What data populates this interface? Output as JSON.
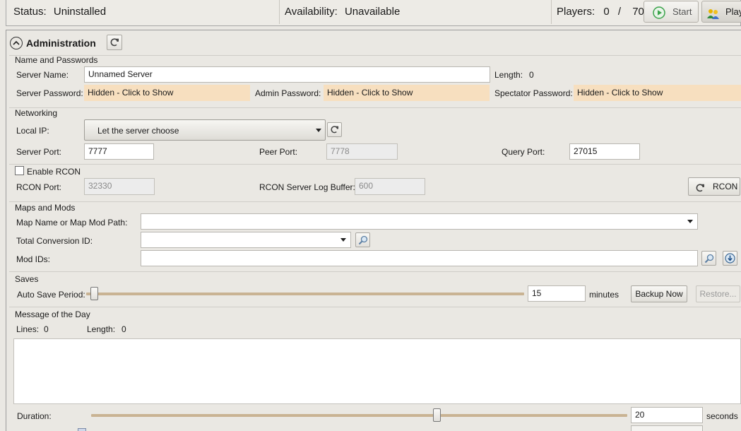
{
  "status_bar": {
    "status_label": "Status:",
    "status_value": "Uninstalled",
    "availability_label": "Availability:",
    "availability_value": "Unavailable",
    "players_label": "Players:",
    "players_current": "0",
    "players_sep": "/",
    "players_max": "70",
    "start_label": "Start",
    "players_button_label": "Playe"
  },
  "admin": {
    "title": "Administration",
    "sections": {
      "names_passwords": "Name and Passwords",
      "networking": "Networking",
      "maps_mods": "Maps and Mods",
      "saves": "Saves",
      "motd": "Message of the Day"
    },
    "server_name_label": "Server Name:",
    "server_name_value": "Unnamed Server",
    "length_label": "Length:",
    "length_value": "0",
    "server_password_label": "Server Password:",
    "server_password_value": "Hidden - Click to Show",
    "admin_password_label": "Admin Password:",
    "admin_password_value": "Hidden - Click to Show",
    "spectator_password_label": "Spectator Password:",
    "spectator_password_value": "Hidden - Click to Show",
    "local_ip_label": "Local IP:",
    "local_ip_value": "Let the server choose",
    "server_port_label": "Server Port:",
    "server_port_value": "7777",
    "peer_port_label": "Peer Port:",
    "peer_port_value": "7778",
    "query_port_label": "Query Port:",
    "query_port_value": "27015",
    "enable_rcon_label": "Enable RCON",
    "rcon_port_label": "RCON Port:",
    "rcon_port_value": "32330",
    "rcon_log_buffer_label": "RCON Server Log Buffer:",
    "rcon_log_buffer_value": "600",
    "rcon_button_label": "RCON",
    "map_label": "Map Name or Map Mod Path:",
    "map_value": "",
    "tc_label": "Total Conversion ID:",
    "tc_value": "",
    "mod_ids_label": "Mod IDs:",
    "mod_ids_value": "",
    "auto_save_label": "Auto Save Period:",
    "auto_save_value": "15",
    "auto_save_unit": "minutes",
    "auto_save_slider_fraction": 0.0,
    "backup_now_label": "Backup Now",
    "restore_label": "Restore...",
    "motd_lines_label": "Lines:",
    "motd_lines_value": "0",
    "motd_length_label": "Length:",
    "motd_length_value": "0",
    "motd_text": "",
    "duration_label": "Duration:",
    "duration_value": "20",
    "duration_unit": "seconds",
    "duration_slider_fraction": 0.65
  },
  "colors": {
    "password_bg": "#f7dfbf",
    "slider_track": "#c9b393",
    "start_icon": "#3aa34a"
  }
}
